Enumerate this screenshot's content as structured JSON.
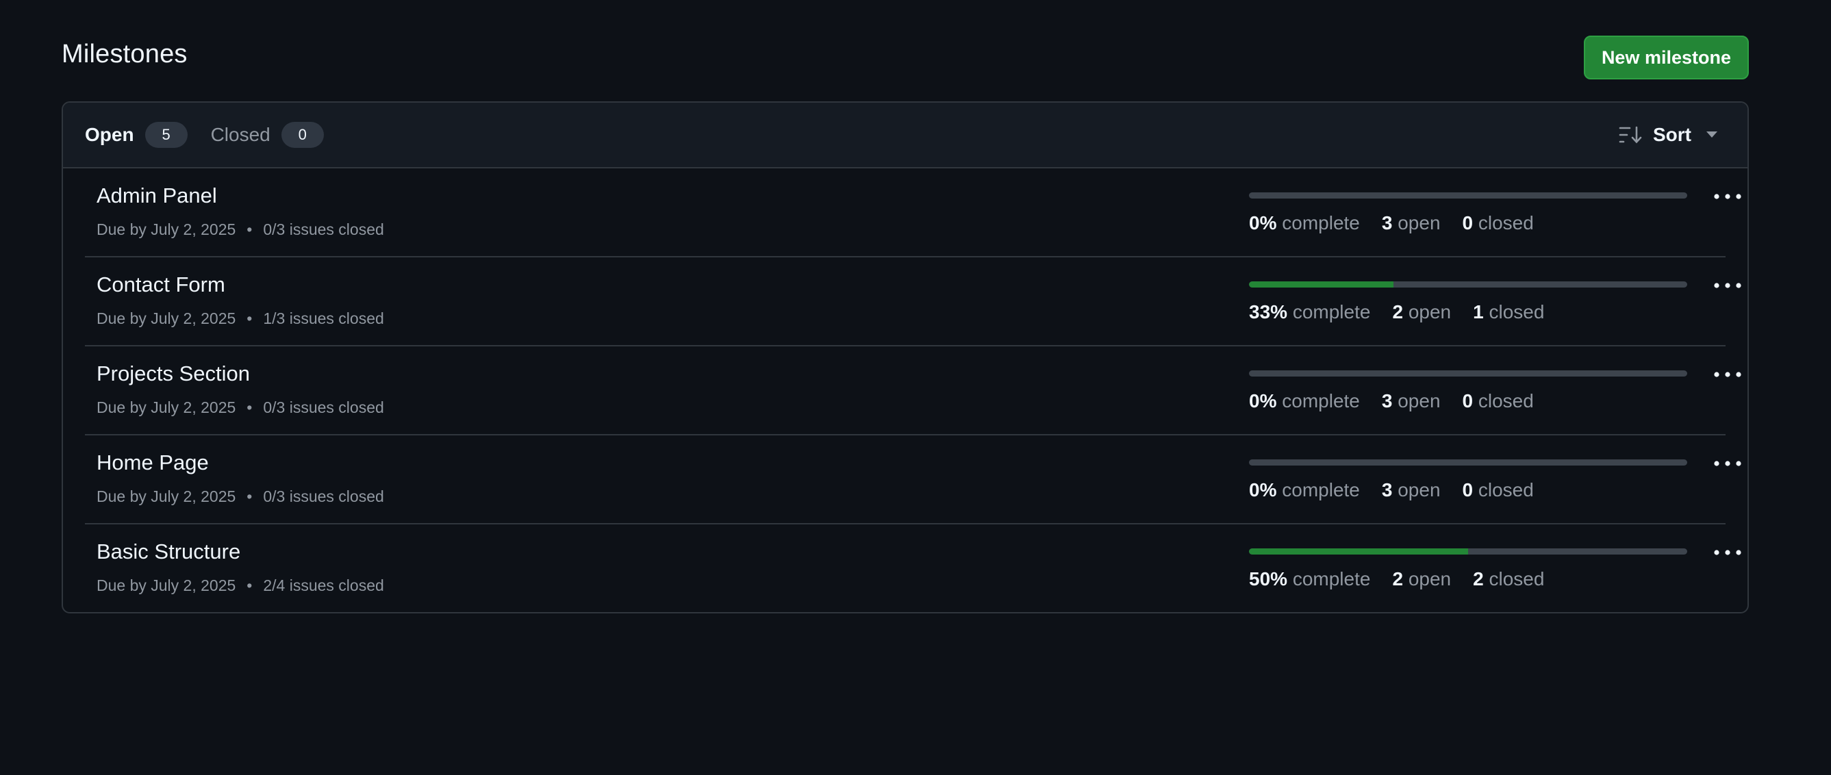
{
  "header": {
    "title": "Milestones",
    "new_button_label": "New milestone"
  },
  "filters": {
    "open_label": "Open",
    "open_count": "5",
    "closed_label": "Closed",
    "closed_count": "0",
    "sort_label": "Sort"
  },
  "milestones": [
    {
      "title": "Admin Panel",
      "due": "Due by July 2, 2025",
      "separator": "•",
      "issues": "0/3 issues closed",
      "percent": "0%",
      "percent_value": 0,
      "complete_label": "complete",
      "open_count": "3",
      "open_label": "open",
      "closed_count": "0",
      "closed_label": "closed"
    },
    {
      "title": "Contact Form",
      "due": "Due by July 2, 2025",
      "separator": "•",
      "issues": "1/3 issues closed",
      "percent": "33%",
      "percent_value": 33,
      "complete_label": "complete",
      "open_count": "2",
      "open_label": "open",
      "closed_count": "1",
      "closed_label": "closed"
    },
    {
      "title": "Projects Section",
      "due": "Due by July 2, 2025",
      "separator": "•",
      "issues": "0/3 issues closed",
      "percent": "0%",
      "percent_value": 0,
      "complete_label": "complete",
      "open_count": "3",
      "open_label": "open",
      "closed_count": "0",
      "closed_label": "closed"
    },
    {
      "title": "Home Page",
      "due": "Due by July 2, 2025",
      "separator": "•",
      "issues": "0/3 issues closed",
      "percent": "0%",
      "percent_value": 0,
      "complete_label": "complete",
      "open_count": "3",
      "open_label": "open",
      "closed_count": "0",
      "closed_label": "closed"
    },
    {
      "title": "Basic Structure",
      "due": "Due by July 2, 2025",
      "separator": "•",
      "issues": "2/4 issues closed",
      "percent": "50%",
      "percent_value": 50,
      "complete_label": "complete",
      "open_count": "2",
      "open_label": "open",
      "closed_count": "2",
      "closed_label": "closed"
    }
  ],
  "icons": {
    "sort": "sort-descending-icon",
    "caret": "triangle-down-icon",
    "more": "kebab-horizontal-icon"
  },
  "colors": {
    "background": "#0d1117",
    "accent_green": "#238636",
    "border": "#30363d",
    "muted_text": "#9198a1"
  }
}
